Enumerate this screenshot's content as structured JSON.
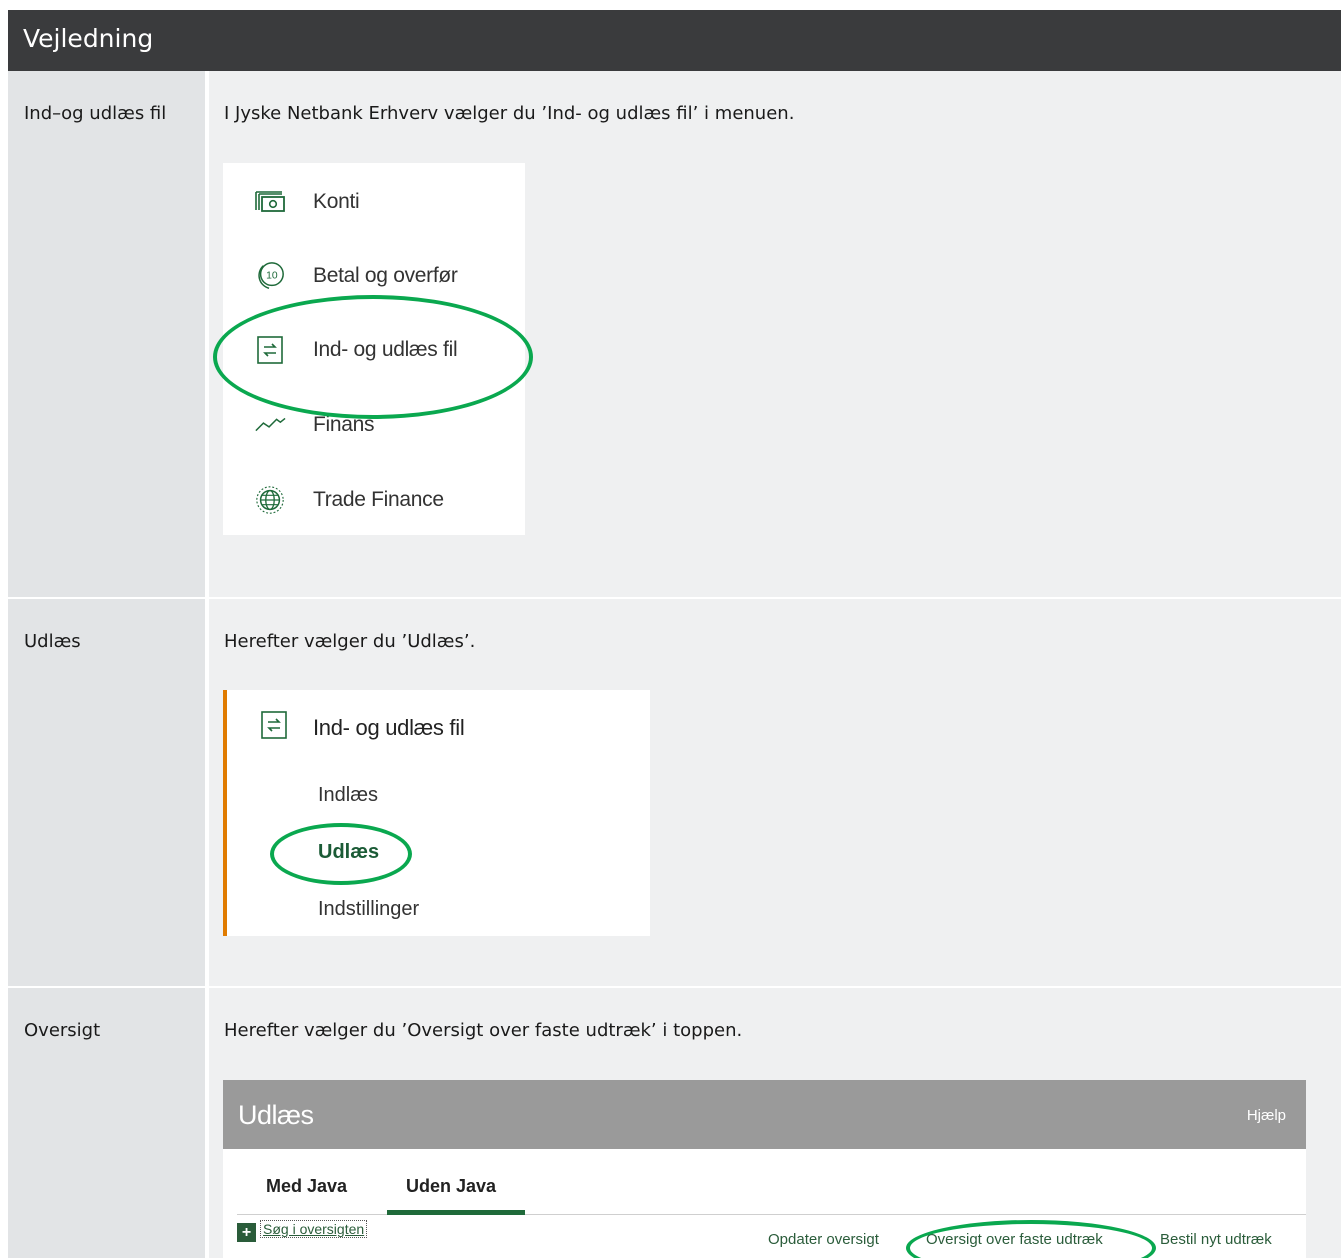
{
  "header": {
    "title": "Vejledning"
  },
  "rows": [
    {
      "label": "Ind–og udlæs fil",
      "text": "I Jyske Netbank Erhverv vælger du ’Ind- og udlæs fil’ i menuen.",
      "menu": {
        "items": [
          {
            "label": "Konti",
            "icon": "accounts-icon"
          },
          {
            "label": "Betal og overfør",
            "icon": "payment-coin-icon"
          },
          {
            "label": "Ind- og udlæs fil",
            "icon": "file-transfer-icon"
          },
          {
            "label": "Finans",
            "icon": "finance-chart-icon"
          },
          {
            "label": "Trade Finance",
            "icon": "globe-icon"
          }
        ],
        "highlighted": "Ind- og udlæs fil"
      }
    },
    {
      "label": "Udlæs",
      "text": "Herefter vælger du ’Udlæs’.",
      "submenu": {
        "title": "Ind- og udlæs fil",
        "items": [
          "Indlæs",
          "Udlæs",
          "Indstillinger"
        ],
        "active": "Udlæs"
      }
    },
    {
      "label": "Oversigt",
      "text": "Herefter vælger du ’Oversigt over faste udtræk’ i toppen.",
      "app": {
        "title": "Udlæs",
        "help": "Hjælp",
        "tabs": [
          "Med Java",
          "Uden Java"
        ],
        "active_tab": "Uden Java",
        "search_link": "Søg i oversigten",
        "links": [
          "Opdater oversigt",
          "Oversigt over faste udtræk",
          "Bestil nyt udtræk"
        ],
        "highlighted": "Oversigt over faste udtræk"
      }
    }
  ],
  "colors": {
    "header_bg": "#3a3b3d",
    "highlight": "#0aa84f",
    "accent_orange": "#e07b00",
    "brand_green": "#1f6a3a"
  }
}
